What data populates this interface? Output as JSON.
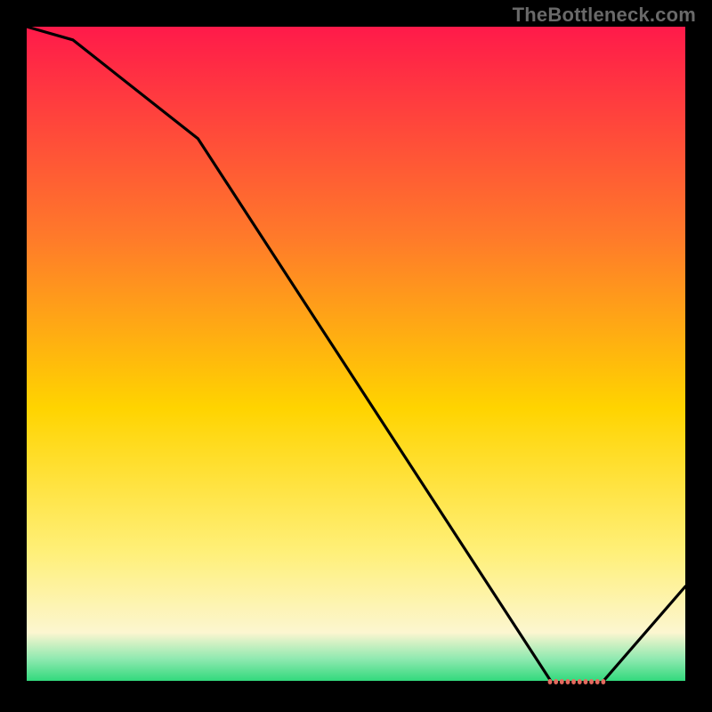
{
  "watermark": "TheBottleneck.com",
  "colors": {
    "top": "#ff1a4a",
    "upper": "#ff7a2a",
    "mid": "#ffd400",
    "lowerY": "#fff07a",
    "cream": "#fcf6d0",
    "green": "#1fd672",
    "black": "#000000",
    "line": "#000000",
    "marker": "#e46a5e"
  },
  "chart_data": {
    "type": "line",
    "title": "",
    "xlabel": "",
    "ylabel": "",
    "xlim": [
      0,
      100
    ],
    "ylim": [
      0,
      100
    ],
    "grid": false,
    "legend": false,
    "x": [
      0,
      7,
      26,
      80,
      87,
      100
    ],
    "values": [
      100,
      98,
      83,
      0,
      0,
      15
    ],
    "marker_segment": {
      "x_start": 79,
      "x_end": 88,
      "y": 0
    }
  }
}
